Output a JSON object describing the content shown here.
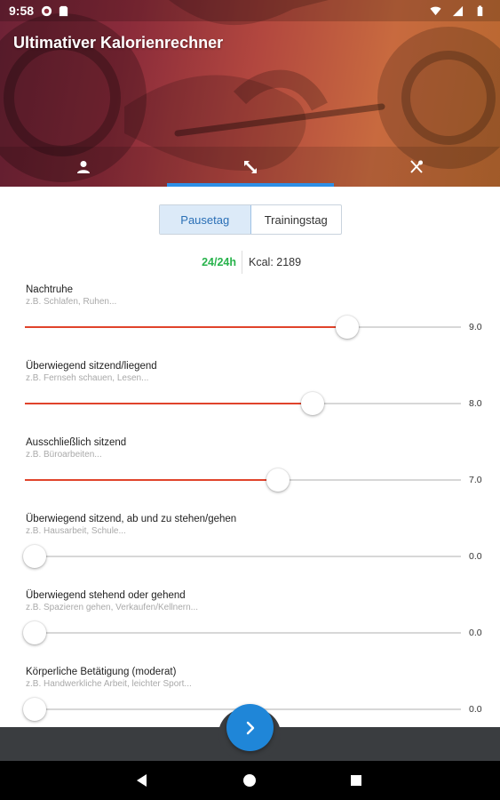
{
  "status_bar": {
    "time": "9:58"
  },
  "app": {
    "title": "Ultimativer Kalorienrechner"
  },
  "tabs": [
    {
      "icon": "person-icon"
    },
    {
      "icon": "expand-icon",
      "active": true
    },
    {
      "icon": "cutlery-icon"
    }
  ],
  "day_type": {
    "options": [
      "Pausetag",
      "Trainingstag"
    ],
    "selected": "Pausetag"
  },
  "summary": {
    "hours": "24/24h",
    "kcal": "Kcal: 2189"
  },
  "activities": [
    {
      "title": "Nachtruhe",
      "hint": "z.B. Schlafen, Ruhen...",
      "value": "9.0",
      "level": 0.74
    },
    {
      "title": "Überwiegend sitzend/liegend",
      "hint": "z.B. Fernseh schauen, Lesen...",
      "value": "8.0",
      "level": 0.66
    },
    {
      "title": "Ausschließlich sitzend",
      "hint": "z.B. Büroarbeiten...",
      "value": "7.0",
      "level": 0.58
    },
    {
      "title": "Überwiegend sitzend, ab und zu stehen/gehen",
      "hint": "z.B. Hausarbeit, Schule...",
      "value": "0.0",
      "level": 0
    },
    {
      "title": "Überwiegend stehend oder gehend",
      "hint": "z.B. Spazieren gehen, Verkaufen/Kellnern...",
      "value": "0.0",
      "level": 0
    },
    {
      "title": "Körperliche Betätigung (moderat)",
      "hint": "z.B. Handwerkliche Arbeit, leichter Sport...",
      "value": "0.0",
      "level": 0
    }
  ],
  "colors": {
    "accent": "#2d8fe6",
    "slider_fill": "#e0432b",
    "hours_ok": "#28b34c",
    "fab": "#1f86d8"
  }
}
